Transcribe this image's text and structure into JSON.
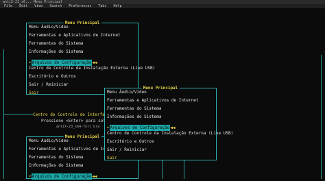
{
  "window": {
    "title": "antiX-23_x6...  Menu Principal"
  },
  "menubar": {
    "items": [
      "File",
      "Edit",
      "View",
      "Search",
      "Preferences",
      "Tabs",
      "Help"
    ]
  },
  "background": {
    "line1": "Centro de Controle de Interface de",
    "line2": "Pressione <Enter> para selecionar uma opção, <b> para volta",
    "line3": "antiX-23_x64-full bra"
  },
  "dialog": {
    "title": "Menu Principal",
    "items": [
      "Menu Áudio/Vídeo",
      "Ferramentas e Aplicativos de Internet",
      "Ferramentas do Sistema",
      "Informações do Sistema",
      "Arquivos de Configuração",
      "Centro de Controle da Instalação Externa (Live USB)",
      "Escritório e Outros",
      "Sair / Reiniciar",
      "Sair"
    ],
    "selected_index": 4,
    "arrow_left": "➤",
    "arrow_right": "◀◀"
  },
  "colors": {
    "accent": "#1aa7a7",
    "title": "#e6d34a",
    "border": "#2fb3b3"
  }
}
